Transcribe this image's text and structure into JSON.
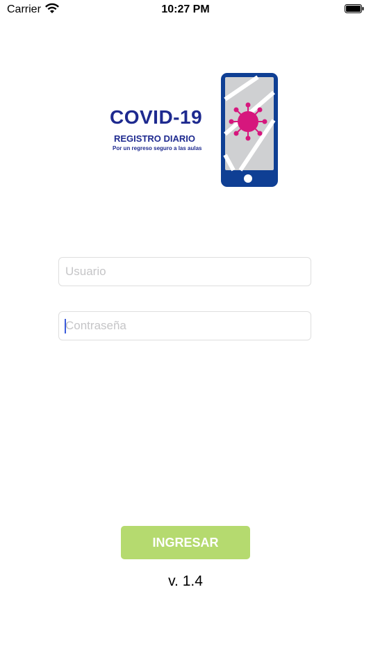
{
  "status_bar": {
    "carrier": "Carrier",
    "time": "10:27 PM"
  },
  "logo": {
    "title": "COVID-19",
    "subtitle": "REGISTRO DIARIO",
    "tagline": "Por un regreso seguro a las aulas"
  },
  "form": {
    "username_placeholder": "Usuario",
    "password_placeholder": "Contraseña",
    "login_label": "INGRESAR"
  },
  "version": "v. 1.4",
  "colors": {
    "brand_blue": "#1e2a8f",
    "virus_magenta": "#d6177d",
    "button_green": "#b5da6f"
  }
}
